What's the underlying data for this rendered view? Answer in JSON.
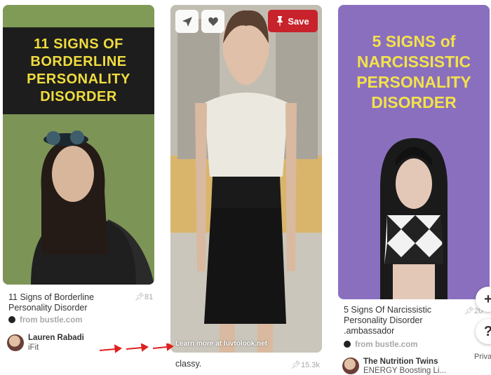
{
  "pins": [
    {
      "title_art": "11 SIGNS OF\nBORDERLINE\nPERSONALITY\nDISORDER",
      "caption_line1": "11 Signs of Borderline",
      "caption_line2": "Personality Disorder",
      "pin_count": "81",
      "source": "from bustle.com",
      "user_name": "Lauren Rabadi",
      "user_board": "iFit"
    },
    {
      "save_label": "Save",
      "learn_more": "Learn more at luvtolook.net",
      "caption_line1": "classy.",
      "pin_count": "15.3k"
    },
    {
      "title_art": "5 SIGNS of\nNARCISSISTIC\nPERSONALITY\nDISORDER",
      "caption_line1": "5 Signs Of Narcissistic",
      "caption_line2": "Personality Disorder",
      "caption_line3": ".ambassador",
      "pin_count": "20",
      "source": "from bustle.com",
      "user_name": "The Nutrition Twins",
      "user_board": "ENERGY Boosting Li..."
    }
  ],
  "fab": {
    "plus": "+",
    "help": "?",
    "privacy": "Priva"
  },
  "colors": {
    "save_red": "#c8232c",
    "arrow_red": "#e02020",
    "banner_yellow": "#f0dc3e",
    "purple_bg": "#8a6fbf"
  }
}
